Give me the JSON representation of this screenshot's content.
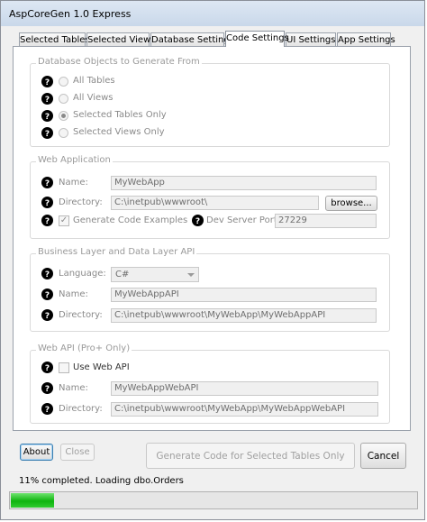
{
  "window": {
    "title": "AspCoreGen 1.0 Express"
  },
  "tabs": [
    {
      "label": "Selected Tables"
    },
    {
      "label": "Selected Views"
    },
    {
      "label": "Database Settings"
    },
    {
      "label": "Code Settings"
    },
    {
      "label": "UI Settings"
    },
    {
      "label": "App Settings"
    }
  ],
  "active_tab": "Code Settings",
  "db_objects": {
    "legend": "Database Objects to Generate From",
    "options": [
      {
        "label": "All Tables",
        "checked": false
      },
      {
        "label": "All Views",
        "checked": false
      },
      {
        "label": "Selected Tables Only",
        "checked": true
      },
      {
        "label": "Selected Views Only",
        "checked": false
      }
    ]
  },
  "web_app": {
    "legend": "Web Application",
    "name_label": "Name:",
    "name_value": "MyWebApp",
    "directory_label": "Directory:",
    "directory_value": "C:\\inetpub\\wwwroot\\",
    "browse_label": "browse...",
    "generate_examples_label": "Generate Code Examples",
    "generate_examples_checked": true,
    "dev_port_label": "Dev Server Port:",
    "dev_port_value": "27229"
  },
  "business_layer": {
    "legend": "Business Layer and Data Layer API",
    "language_label": "Language:",
    "language_value": "C#",
    "name_label": "Name:",
    "name_value": "MyWebAppAPI",
    "directory_label": "Directory:",
    "directory_value": "C:\\inetpub\\wwwroot\\MyWebApp\\MyWebAppAPI"
  },
  "web_api": {
    "legend": "Web API (Pro+ Only)",
    "use_label": "Use Web API",
    "use_checked": false,
    "name_label": "Name:",
    "name_value": "MyWebAppWebAPI",
    "directory_label": "Directory:",
    "directory_value": "C:\\inetpub\\wwwroot\\MyWebApp\\MyWebAppWebAPI"
  },
  "buttons": {
    "about": "About",
    "close": "Close",
    "generate": "Generate Code for Selected Tables Only",
    "cancel": "Cancel"
  },
  "status": {
    "text": "11% completed.  Loading dbo.Orders",
    "progress_percent": 11
  },
  "icons": {
    "help": "help-question-icon"
  },
  "colors": {
    "progress_fill": "#0fb40f",
    "focus_border": "#3c7fb1"
  }
}
